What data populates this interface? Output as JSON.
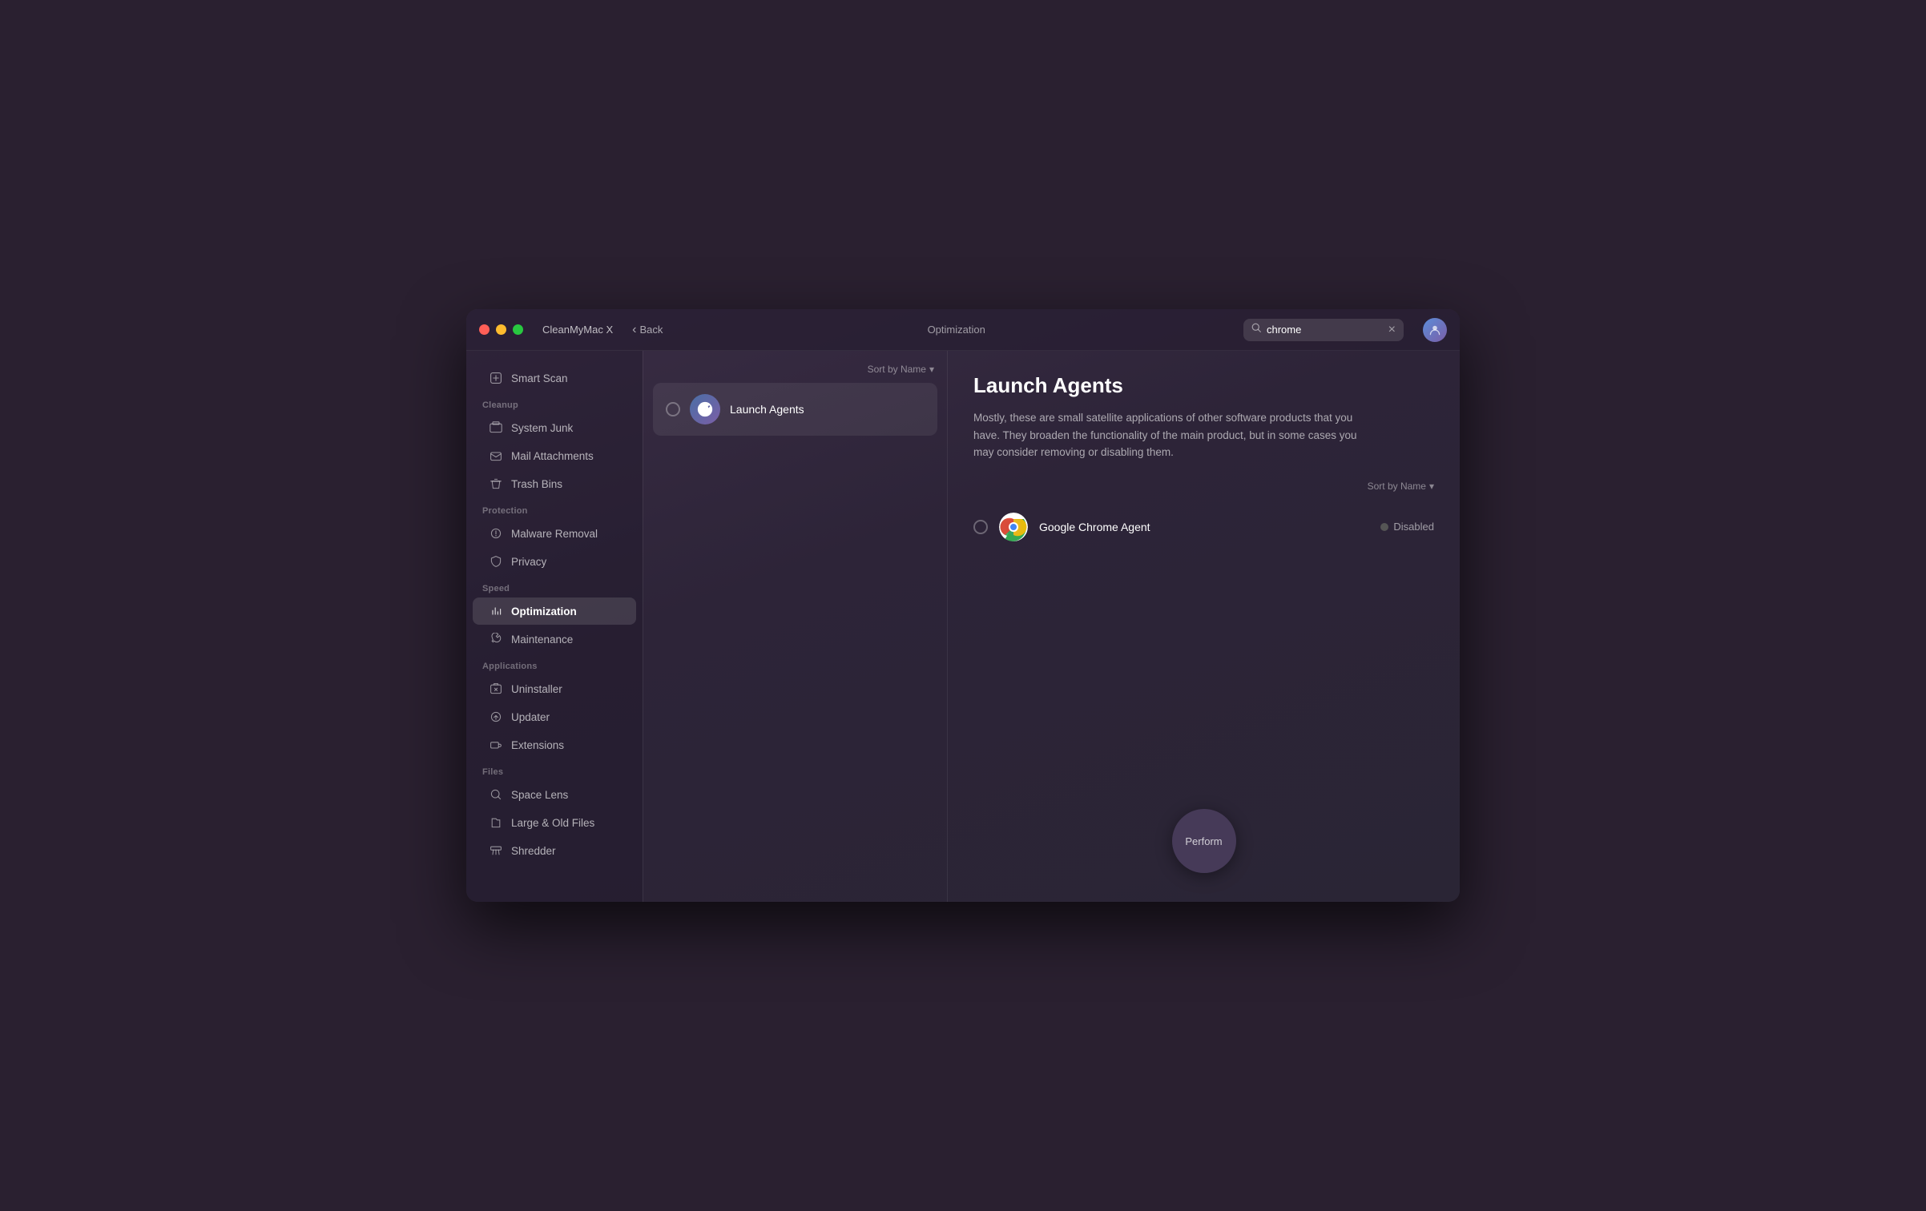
{
  "window": {
    "title": "CleanMyMac X",
    "back_label": "Back",
    "section_title": "Optimization"
  },
  "search": {
    "placeholder": "Search",
    "value": "chrome",
    "clear_label": "×"
  },
  "sidebar": {
    "smart_scan": "Smart Scan",
    "sections": [
      {
        "label": "Cleanup",
        "items": [
          {
            "id": "system-junk",
            "label": "System Junk"
          },
          {
            "id": "mail-attachments",
            "label": "Mail Attachments"
          },
          {
            "id": "trash-bins",
            "label": "Trash Bins"
          }
        ]
      },
      {
        "label": "Protection",
        "items": [
          {
            "id": "malware-removal",
            "label": "Malware Removal"
          },
          {
            "id": "privacy",
            "label": "Privacy"
          }
        ]
      },
      {
        "label": "Speed",
        "items": [
          {
            "id": "optimization",
            "label": "Optimization",
            "active": true
          },
          {
            "id": "maintenance",
            "label": "Maintenance"
          }
        ]
      },
      {
        "label": "Applications",
        "items": [
          {
            "id": "uninstaller",
            "label": "Uninstaller"
          },
          {
            "id": "updater",
            "label": "Updater"
          },
          {
            "id": "extensions",
            "label": "Extensions"
          }
        ]
      },
      {
        "label": "Files",
        "items": [
          {
            "id": "space-lens",
            "label": "Space Lens"
          },
          {
            "id": "large-old-files",
            "label": "Large & Old Files"
          },
          {
            "id": "shredder",
            "label": "Shredder"
          }
        ]
      }
    ]
  },
  "list_pane": {
    "sort_label": "Sort by Name",
    "sort_arrow": "▾",
    "items": [
      {
        "id": "launch-agents",
        "label": "Launch Agents"
      }
    ]
  },
  "detail": {
    "title": "Launch Agents",
    "description": "Mostly, these are small satellite applications of other software products that you have. They broaden the functionality of the main product, but in some cases you may consider removing or disabling them.",
    "sort_label": "Sort by Name",
    "sort_arrow": "▾",
    "agents": [
      {
        "id": "google-chrome-agent",
        "name": "Google Chrome Agent",
        "status": "Disabled"
      }
    ]
  },
  "perform_button": "Perform",
  "icons": {
    "search": "🔍",
    "smart_scan": "⚡",
    "system_junk": "🖥",
    "mail": "✉",
    "trash": "🗑",
    "malware": "☣",
    "privacy": "🤚",
    "optimization": "⚡",
    "maintenance": "🔧",
    "uninstaller": "🗂",
    "updater": "↑",
    "extensions": "⇥",
    "space_lens": "⬤",
    "large_files": "📁",
    "shredder": "⬛",
    "back_arrow": "‹",
    "launch_agents": "🚀"
  },
  "colors": {
    "accent": "#7b5ea7",
    "active_bg": "rgba(255,255,255,0.12)",
    "disabled_dot": "#555"
  }
}
